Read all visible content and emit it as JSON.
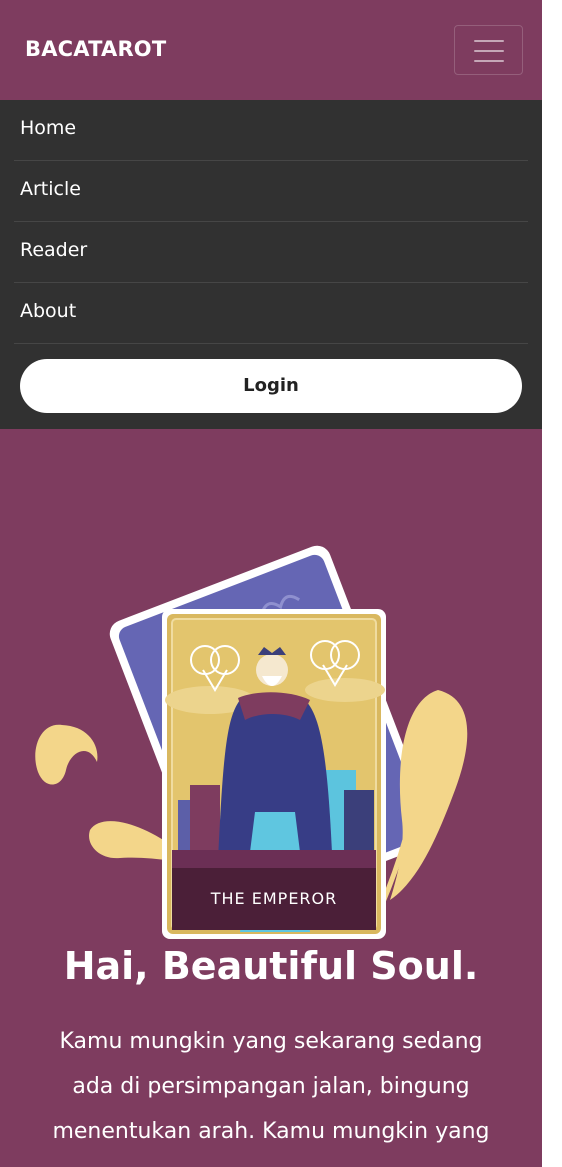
{
  "navbar": {
    "brand": "BACATAROT",
    "toggle_icon": "hamburger-icon"
  },
  "menu": {
    "items": [
      {
        "label": "Home"
      },
      {
        "label": "Article"
      },
      {
        "label": "Reader"
      },
      {
        "label": "About"
      }
    ],
    "login_label": "Login"
  },
  "hero": {
    "card_title": "THE EMPEROR",
    "title": "Hai, Beautiful Soul.",
    "text": "Kamu mungkin yang sekarang sedang ada di persimpangan jalan, bingung menentukan arah. Kamu mungkin yang"
  },
  "colors": {
    "background": "#7e3c5f",
    "menu_background": "#313131",
    "card_gold": "#d9b85f",
    "card_back_blue": "#6566b4",
    "accent_yellow": "#f3d68a"
  }
}
